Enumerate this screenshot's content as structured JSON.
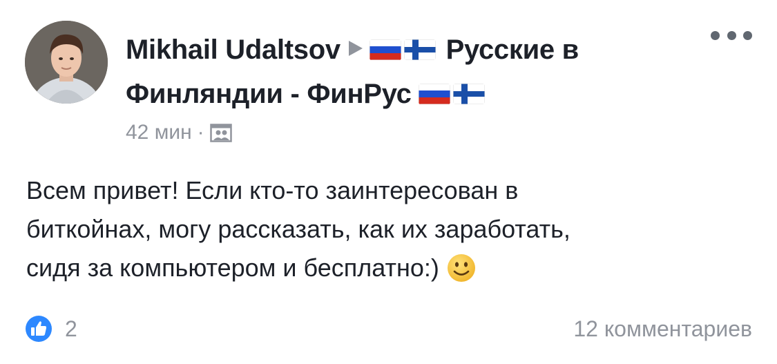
{
  "post": {
    "author": "Mikhail Udaltsov",
    "group_name_part1": "Русские в",
    "group_name_part2": "Финляндии - ФинРус",
    "timestamp": "42 мин",
    "separator": "·",
    "audience_icon": "group-audience-icon",
    "message_lines": [
      "Всем привет! Если кто-то заинтересован в",
      "биткойнах, могу рассказать, как их заработать,",
      "сидя за компьютером и бесплатно:)"
    ],
    "emoji": "smiley-face-icon",
    "like_count": "2",
    "comments": "12 комментариев"
  },
  "colors": {
    "text_primary": "#1d2129",
    "text_secondary": "#90949c",
    "like_blue": "#2d88ff",
    "emoji_yellow": "#f7c94a"
  }
}
